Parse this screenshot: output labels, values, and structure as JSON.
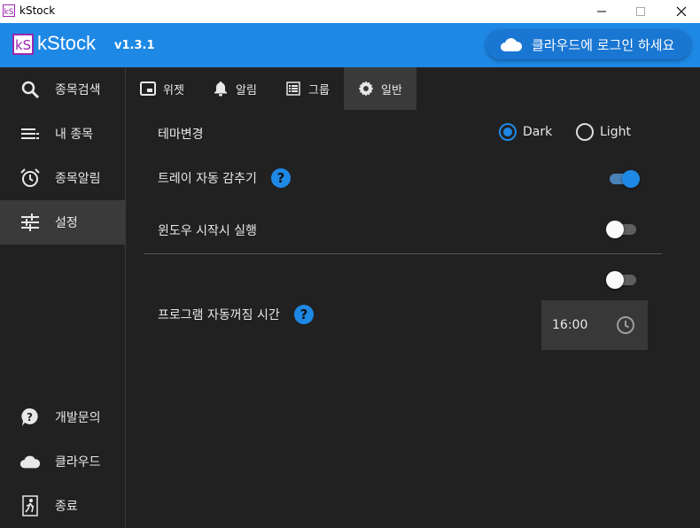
{
  "window": {
    "title": "kStock",
    "logo_text": "kS"
  },
  "header": {
    "app_name": "kStock",
    "version": "v1.3.1",
    "login_button": "클라우드에 로그인 하세요",
    "accent": "#1e88e5"
  },
  "sidebar": {
    "items": [
      {
        "label": "종목검색",
        "icon": "search-icon"
      },
      {
        "label": "내 종목",
        "icon": "list-icon"
      },
      {
        "label": "종목알림",
        "icon": "alarm-clock-icon"
      },
      {
        "label": "설정",
        "icon": "tune-icon",
        "active": true
      }
    ],
    "bottom_items": [
      {
        "label": "개발문의",
        "icon": "help-bubble-icon"
      },
      {
        "label": "클라우드",
        "icon": "cloud-icon"
      },
      {
        "label": "종료",
        "icon": "exit-icon"
      }
    ]
  },
  "tabs": [
    {
      "label": "위젯",
      "icon": "widget-icon"
    },
    {
      "label": "알림",
      "icon": "bell-icon"
    },
    {
      "label": "그룹",
      "icon": "grid-list-icon"
    },
    {
      "label": "일반",
      "icon": "gear-icon",
      "active": true
    }
  ],
  "settings": {
    "theme": {
      "label": "테마변경",
      "options": [
        "Dark",
        "Light"
      ],
      "selected": "Dark"
    },
    "tray_autohide": {
      "label": "트레이 자동 감추기",
      "help": "?",
      "enabled": true
    },
    "run_on_startup": {
      "label": "윈도우 시작시 실행",
      "enabled": false
    },
    "auto_shutdown": {
      "label": "프로그램 자동꺼짐 시간",
      "help": "?",
      "enabled": false,
      "time": "16:00"
    }
  }
}
